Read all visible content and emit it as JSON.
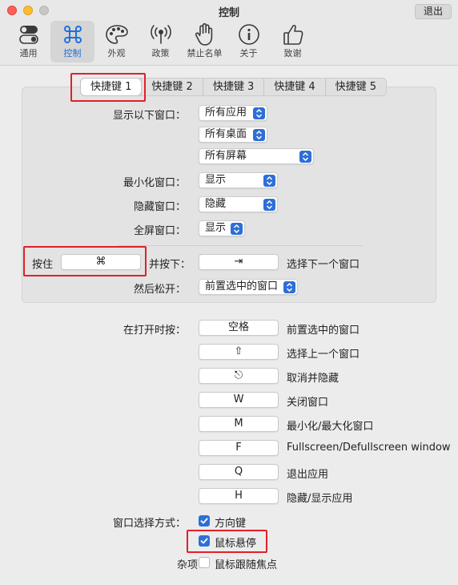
{
  "window": {
    "title": "控制",
    "quit_label": "退出"
  },
  "toolbar": {
    "items": [
      {
        "label": "通用",
        "icon": "toggles-icon"
      },
      {
        "label": "控制",
        "icon": "command-icon",
        "active": true
      },
      {
        "label": "外观",
        "icon": "palette-icon"
      },
      {
        "label": "政策",
        "icon": "antenna-icon"
      },
      {
        "label": "禁止名单",
        "icon": "hand-icon"
      },
      {
        "label": "关于",
        "icon": "info-icon"
      },
      {
        "label": "致谢",
        "icon": "thumbs-up-icon"
      }
    ]
  },
  "accent_color": "#2d6fd6",
  "highlight_color": "#e0202a",
  "shortcut_tabs": [
    "快捷键 1",
    "快捷键 2",
    "快捷键 3",
    "快捷键 4",
    "快捷键 5"
  ],
  "shortcut": {
    "show_windows_label": "显示以下窗口：",
    "show_apps": "所有应用",
    "show_spaces": "所有桌面",
    "show_screens": "所有屏幕",
    "minimized_label": "最小化窗口：",
    "minimized_value": "显示",
    "hidden_label": "隐藏窗口：",
    "hidden_value": "隐藏",
    "fullscreen_label": "全屏窗口：",
    "fullscreen_value": "显示",
    "hold_label": "按住",
    "hold_key": "⌘",
    "and_press_label": "并按下：",
    "press_key": "⇥",
    "press_action": "选择下一个窗口",
    "release_label": "然后松开：",
    "release_value": "前置选中的窗口"
  },
  "while_open": {
    "label": "在打开时按：",
    "rows": [
      {
        "key": "空格",
        "action": "前置选中的窗口"
      },
      {
        "key": "⇧",
        "action": "选择上一个窗口"
      },
      {
        "key": "⎋",
        "action": "取消并隐藏"
      },
      {
        "key": "W",
        "action": "关闭窗口"
      },
      {
        "key": "M",
        "action": "最小化/最大化窗口"
      },
      {
        "key": "F",
        "action": "Fullscreen/Defullscreen window"
      },
      {
        "key": "Q",
        "action": "退出应用"
      },
      {
        "key": "H",
        "action": "隐藏/显示应用"
      }
    ]
  },
  "selection": {
    "label": "窗口选择方式：",
    "arrow_keys": "方向键",
    "arrow_keys_checked": true,
    "mouse_hover": "鼠标悬停",
    "mouse_hover_checked": true
  },
  "misc": {
    "label": "杂项：",
    "focus_follows_mouse": "鼠标跟随焦点",
    "focus_follows_mouse_checked": false
  }
}
